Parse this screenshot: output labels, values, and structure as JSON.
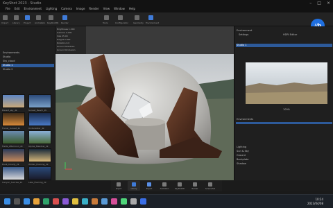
{
  "window": {
    "title": "KeyShot 2023 · Studio",
    "menu": [
      "File",
      "Edit",
      "Environment",
      "Lighting",
      "Camera",
      "Image",
      "Render",
      "View",
      "Window",
      "Help"
    ],
    "controls": [
      "–",
      "□",
      "×"
    ]
  },
  "brand": {
    "badge": "//b"
  },
  "toolbar": {
    "labels": [
      "Import",
      "Library",
      "Project",
      "Animation",
      "KeyShotXR",
      "Render",
      "Tools",
      "Configurator",
      "Geometry",
      "Environment"
    ]
  },
  "left_panel": {
    "tree": [
      "Environments",
      "Studio",
      "Sky_cloud",
      "Studio 1",
      "Studio 2"
    ],
    "selected_index": 3,
    "thumbnails": [
      "Desert_sky_4k",
      "Sunset_Beach_2k",
      "Forest_Sunset_2k",
      "Underwater_4k",
      "Fields_Afternoon_2k",
      "Alpine_Meadow_2k",
      "Dusk_Cloudy_2k",
      "Winter_Evening_2k",
      "Canyon_Sunrise_2k",
      "Lake_Evening_2k"
    ]
  },
  "props_panel": {
    "lines": [
      "Brightness 1.000",
      "Gamma 1.000",
      "Size 25.00",
      "Height 0.000",
      "Rotation 0.0",
      "Ground Shadows",
      "Ground Occlusion"
    ]
  },
  "right_panel": {
    "header": "Environment",
    "tabs": [
      "Settings",
      "HDRI Editor"
    ],
    "selected": "Studio 1",
    "list_header": "Environments",
    "settings": [
      "Lighting",
      "Sun & Sky",
      "Ground",
      "Backplate",
      "Shadow"
    ],
    "zoom": "100%"
  },
  "bottom_bar": {
    "buttons": [
      {
        "label": "Import",
        "color": "#7a7a7a"
      },
      {
        "label": "Library",
        "color": "#3f7bd8"
      },
      {
        "label": "Project",
        "color": "#5a8fe6"
      },
      {
        "label": "Animation",
        "color": "#7a7a7a"
      },
      {
        "label": "KeyShotXR",
        "color": "#7a7a7a"
      },
      {
        "label": "Render",
        "color": "#7a7a7a"
      },
      {
        "label": "Screenshot",
        "color": "#7a7a7a"
      }
    ],
    "active_index": 1
  },
  "taskbar": {
    "time": "10:24",
    "date": "2023/04/08",
    "apps": [
      "#3a8ee6",
      "#e6a23a",
      "#2fa36b",
      "#d94f4f",
      "#8a5ad6",
      "#e0c040",
      "#3ab0c8",
      "#c87a3a",
      "#5a9ad6",
      "#d64f9a",
      "#4fd67a",
      "#aaaaaa",
      "#3a6ee6"
    ]
  }
}
